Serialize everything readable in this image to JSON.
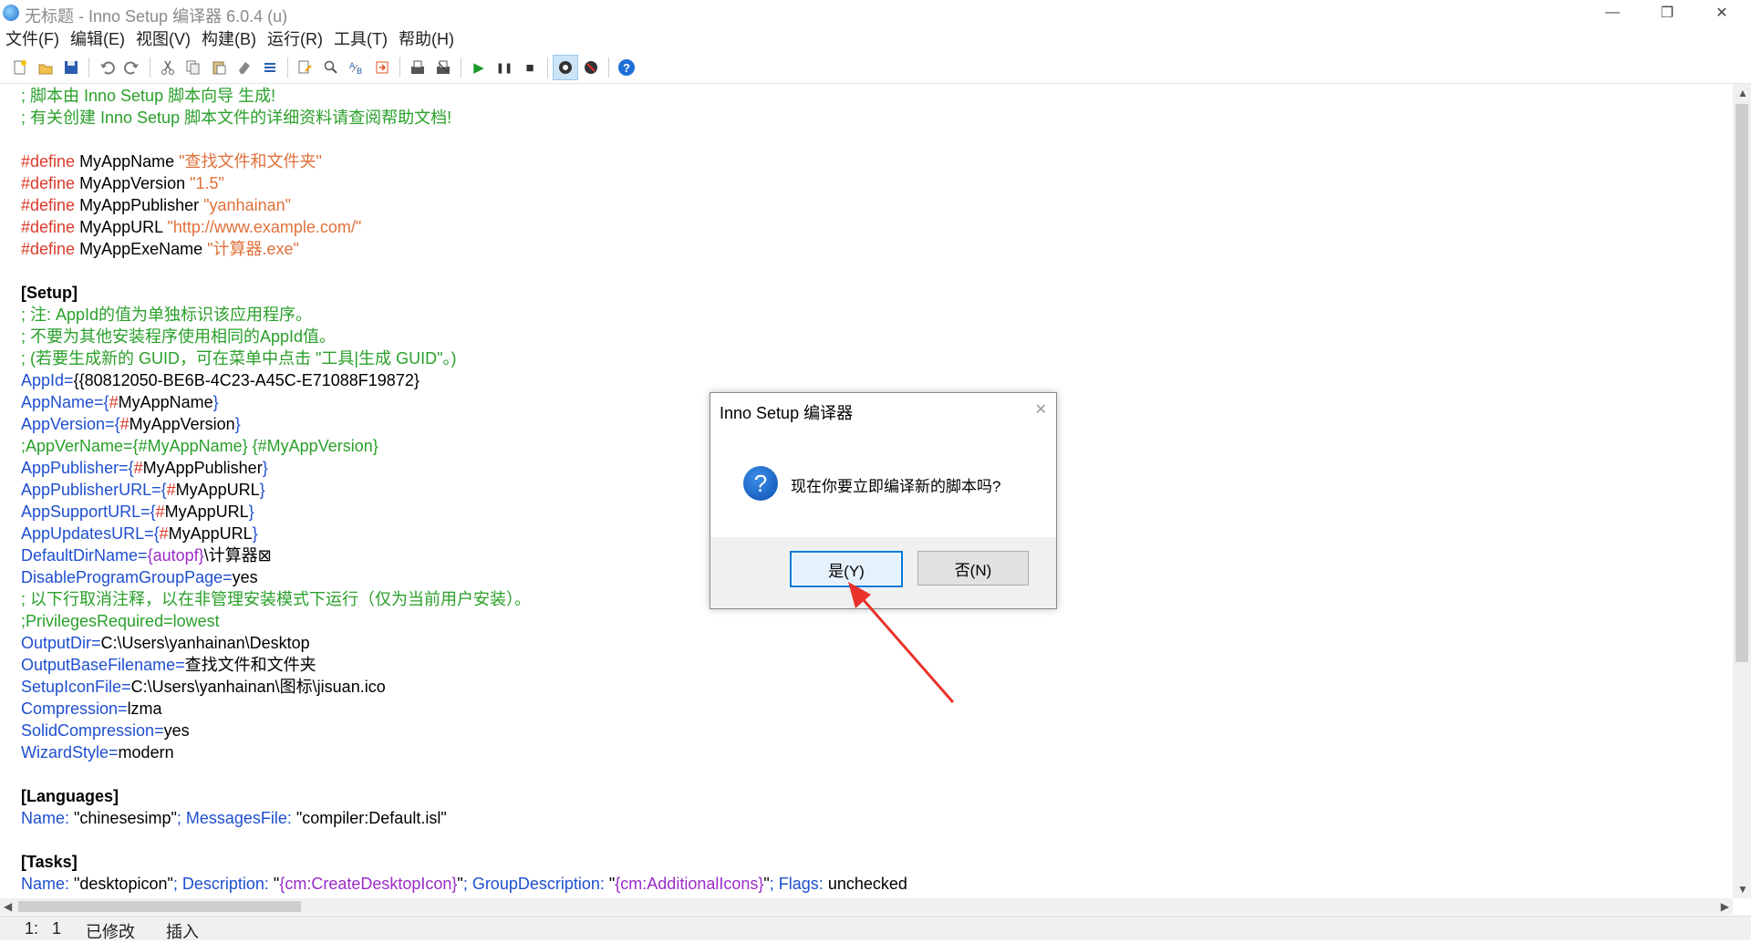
{
  "window": {
    "title": "无标题 - Inno Setup 编译器 6.0.4 (u)",
    "controls": {
      "minimize": "—",
      "restore": "❐",
      "close": "✕"
    }
  },
  "menu": [
    "文件(F)",
    "编辑(E)",
    "视图(V)",
    "构建(B)",
    "运行(R)",
    "工具(T)",
    "帮助(H)"
  ],
  "toolbar": {
    "icons": [
      "new-icon",
      "open-icon",
      "save-icon",
      "undo-icon",
      "redo-icon",
      "cut-icon",
      "copy-icon",
      "paste-icon",
      "delete-icon",
      "select-all-icon",
      "find-icon",
      "find-next-icon",
      "replace-icon",
      "goto-icon",
      "compile-icon",
      "stop-compile-icon",
      "run-icon",
      "pause-icon",
      "stop-icon",
      "target-setup-icon",
      "target-uninstall-icon",
      "help-icon"
    ],
    "glyphs": {
      "run": "▶",
      "pause": "❚❚",
      "stop": "■",
      "help": "?"
    }
  },
  "editor": {
    "lines": [
      [
        {
          "t": "; 脚本由 Inno Setup 脚本向导 生成!",
          "c": "comment"
        }
      ],
      [
        {
          "t": "; 有关创建 Inno Setup 脚本文件的详细资料请查阅帮助文档!",
          "c": "comment"
        }
      ],
      [],
      [
        {
          "t": "#define",
          "c": "define"
        },
        {
          "t": " MyAppName ",
          "c": "plain"
        },
        {
          "t": "\"查找文件和文件夹\"",
          "c": "str"
        }
      ],
      [
        {
          "t": "#define",
          "c": "define"
        },
        {
          "t": " MyAppVersion ",
          "c": "plain"
        },
        {
          "t": "\"1.5\"",
          "c": "str"
        }
      ],
      [
        {
          "t": "#define",
          "c": "define"
        },
        {
          "t": " MyAppPublisher ",
          "c": "plain"
        },
        {
          "t": "\"yanhainan\"",
          "c": "str"
        }
      ],
      [
        {
          "t": "#define",
          "c": "define"
        },
        {
          "t": " MyAppURL ",
          "c": "plain"
        },
        {
          "t": "\"http://www.example.com/\"",
          "c": "str"
        }
      ],
      [
        {
          "t": "#define",
          "c": "define"
        },
        {
          "t": " MyAppExeName ",
          "c": "plain"
        },
        {
          "t": "\"计算器.exe\"",
          "c": "str"
        }
      ],
      [],
      [
        {
          "t": "[Setup]",
          "c": "sec"
        }
      ],
      [
        {
          "t": "; 注: AppId的值为单独标识该应用程序。",
          "c": "comment"
        }
      ],
      [
        {
          "t": "; 不要为其他安装程序使用相同的AppId值。",
          "c": "comment"
        }
      ],
      [
        {
          "t": "; (若要生成新的 GUID，可在菜单中点击 \"工具|生成 GUID\"。)",
          "c": "comment"
        }
      ],
      [
        {
          "t": "AppId",
          "c": "key"
        },
        {
          "t": "=",
          "c": "key"
        },
        {
          "t": "{{80812050-BE6B-4C23-A45C-E71088F19872}",
          "c": "plain"
        }
      ],
      [
        {
          "t": "AppName",
          "c": "key"
        },
        {
          "t": "={",
          "c": "key"
        },
        {
          "t": "#",
          "c": "define"
        },
        {
          "t": "MyAppName",
          "c": "plain"
        },
        {
          "t": "}",
          "c": "key"
        }
      ],
      [
        {
          "t": "AppVersion",
          "c": "key"
        },
        {
          "t": "={",
          "c": "key"
        },
        {
          "t": "#",
          "c": "define"
        },
        {
          "t": "MyAppVersion",
          "c": "plain"
        },
        {
          "t": "}",
          "c": "key"
        }
      ],
      [
        {
          "t": ";AppVerName={#MyAppName} {#MyAppVersion}",
          "c": "comment"
        }
      ],
      [
        {
          "t": "AppPublisher",
          "c": "key"
        },
        {
          "t": "={",
          "c": "key"
        },
        {
          "t": "#",
          "c": "define"
        },
        {
          "t": "MyAppPublisher",
          "c": "plain"
        },
        {
          "t": "}",
          "c": "key"
        }
      ],
      [
        {
          "t": "AppPublisherURL",
          "c": "key"
        },
        {
          "t": "={",
          "c": "key"
        },
        {
          "t": "#",
          "c": "define"
        },
        {
          "t": "MyAppURL",
          "c": "plain"
        },
        {
          "t": "}",
          "c": "key"
        }
      ],
      [
        {
          "t": "AppSupportURL",
          "c": "key"
        },
        {
          "t": "={",
          "c": "key"
        },
        {
          "t": "#",
          "c": "define"
        },
        {
          "t": "MyAppURL",
          "c": "plain"
        },
        {
          "t": "}",
          "c": "key"
        }
      ],
      [
        {
          "t": "AppUpdatesURL",
          "c": "key"
        },
        {
          "t": "={",
          "c": "key"
        },
        {
          "t": "#",
          "c": "define"
        },
        {
          "t": "MyAppURL",
          "c": "plain"
        },
        {
          "t": "}",
          "c": "key"
        }
      ],
      [
        {
          "t": "DefaultDirName",
          "c": "key"
        },
        {
          "t": "=",
          "c": "key"
        },
        {
          "t": "{autopf}",
          "c": "const"
        },
        {
          "t": "\\计算器⊠",
          "c": "plain"
        }
      ],
      [
        {
          "t": "DisableProgramGroupPage",
          "c": "key"
        },
        {
          "t": "=",
          "c": "key"
        },
        {
          "t": "yes",
          "c": "plain"
        }
      ],
      [
        {
          "t": "; 以下行取消注释，以在非管理安装模式下运行（仅为当前用户安装）。",
          "c": "comment"
        }
      ],
      [
        {
          "t": ";PrivilegesRequired=lowest",
          "c": "comment"
        }
      ],
      [
        {
          "t": "OutputDir",
          "c": "key"
        },
        {
          "t": "=",
          "c": "key"
        },
        {
          "t": "C:\\Users\\yanhainan\\Desktop",
          "c": "plain"
        }
      ],
      [
        {
          "t": "OutputBaseFilename",
          "c": "key"
        },
        {
          "t": "=",
          "c": "key"
        },
        {
          "t": "查找文件和文件夹",
          "c": "plain"
        }
      ],
      [
        {
          "t": "SetupIconFile",
          "c": "key"
        },
        {
          "t": "=",
          "c": "key"
        },
        {
          "t": "C:\\Users\\yanhainan\\图标\\jisuan.ico",
          "c": "plain"
        }
      ],
      [
        {
          "t": "Compression",
          "c": "key"
        },
        {
          "t": "=",
          "c": "key"
        },
        {
          "t": "lzma",
          "c": "plain"
        }
      ],
      [
        {
          "t": "SolidCompression",
          "c": "key"
        },
        {
          "t": "=",
          "c": "key"
        },
        {
          "t": "yes",
          "c": "plain"
        }
      ],
      [
        {
          "t": "WizardStyle",
          "c": "key"
        },
        {
          "t": "=",
          "c": "key"
        },
        {
          "t": "modern",
          "c": "plain"
        }
      ],
      [],
      [
        {
          "t": "[Languages]",
          "c": "sec"
        }
      ],
      [
        {
          "t": "Name:",
          "c": "key"
        },
        {
          "t": " \"chinesesimp\"",
          "c": "plain"
        },
        {
          "t": "; MessagesFile:",
          "c": "key"
        },
        {
          "t": " \"compiler:Default.isl\"",
          "c": "plain"
        }
      ],
      [],
      [
        {
          "t": "[Tasks]",
          "c": "sec"
        }
      ],
      [
        {
          "t": "Name:",
          "c": "key"
        },
        {
          "t": " \"desktopicon\"",
          "c": "plain"
        },
        {
          "t": "; Description:",
          "c": "key"
        },
        {
          "t": " \"",
          "c": "plain"
        },
        {
          "t": "{cm:CreateDesktopIcon}",
          "c": "const"
        },
        {
          "t": "\"",
          "c": "plain"
        },
        {
          "t": "; GroupDescription:",
          "c": "key"
        },
        {
          "t": " \"",
          "c": "plain"
        },
        {
          "t": "{cm:AdditionalIcons}",
          "c": "const"
        },
        {
          "t": "\"",
          "c": "plain"
        },
        {
          "t": "; Flags:",
          "c": "key"
        },
        {
          "t": " unchecked",
          "c": "plain"
        }
      ]
    ]
  },
  "status": {
    "line": "1:",
    "col": "1",
    "modified": "已修改",
    "mode": "插入"
  },
  "dialog": {
    "title": "Inno Setup 编译器",
    "message": "现在你要立即编译新的脚本吗?",
    "yes_label": "是(Y)",
    "no_label": "否(N)",
    "close_glyph": "✕",
    "icon_glyph": "?"
  },
  "colors": {
    "comment": "#2aa02a",
    "define": "#d93b2b",
    "string": "#e0703a",
    "keyword": "#1f4fd0",
    "constant": "#9b2bc8",
    "annotation_arrow": "#e8322b"
  }
}
